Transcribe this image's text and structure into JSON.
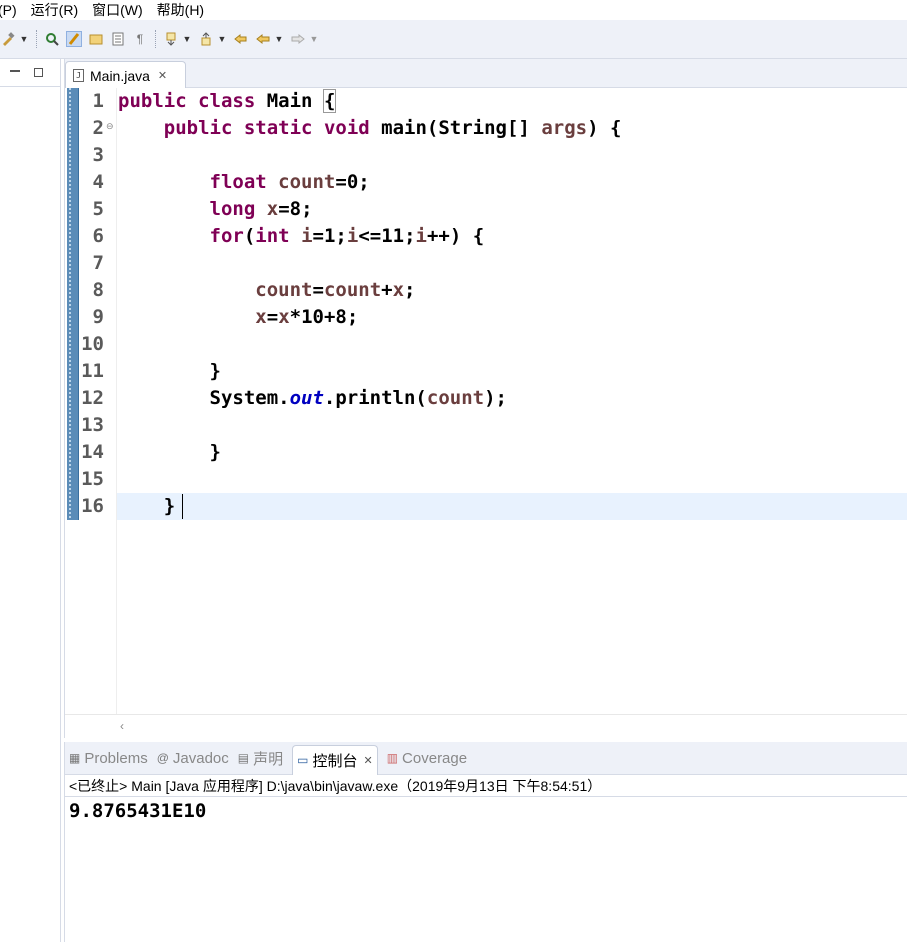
{
  "menu": {
    "items": [
      "(P)",
      "运行(R)",
      "窗口(W)",
      "帮助(H)"
    ]
  },
  "editor": {
    "tab_label": "Main.java",
    "line_numbers": [
      "1",
      "2",
      "3",
      "4",
      "5",
      "6",
      "7",
      "8",
      "9",
      "10",
      "11",
      "12",
      "13",
      "14",
      "15",
      "16"
    ],
    "current_line": 16
  },
  "bottom": {
    "tabs": [
      {
        "label": "Problems",
        "icon": "problems-icon"
      },
      {
        "label": "Javadoc",
        "icon": "javadoc-icon"
      },
      {
        "label": "声明",
        "icon": "declaration-icon"
      },
      {
        "label": "控制台",
        "icon": "console-icon",
        "active": true
      },
      {
        "label": "Coverage",
        "icon": "coverage-icon"
      }
    ],
    "console_description": "<已终止> Main [Java 应用程序] D:\\java\\bin\\javaw.exe（2019年9月13日 下午8:54:51）",
    "console_output": "9.8765431E10"
  },
  "colors": {
    "keyword": "#7f0055",
    "variable": "#6a3e3e",
    "field": "#0000c0",
    "current_line_bg": "#e8f2fe",
    "toolbar_bg": "#eef1f8"
  }
}
